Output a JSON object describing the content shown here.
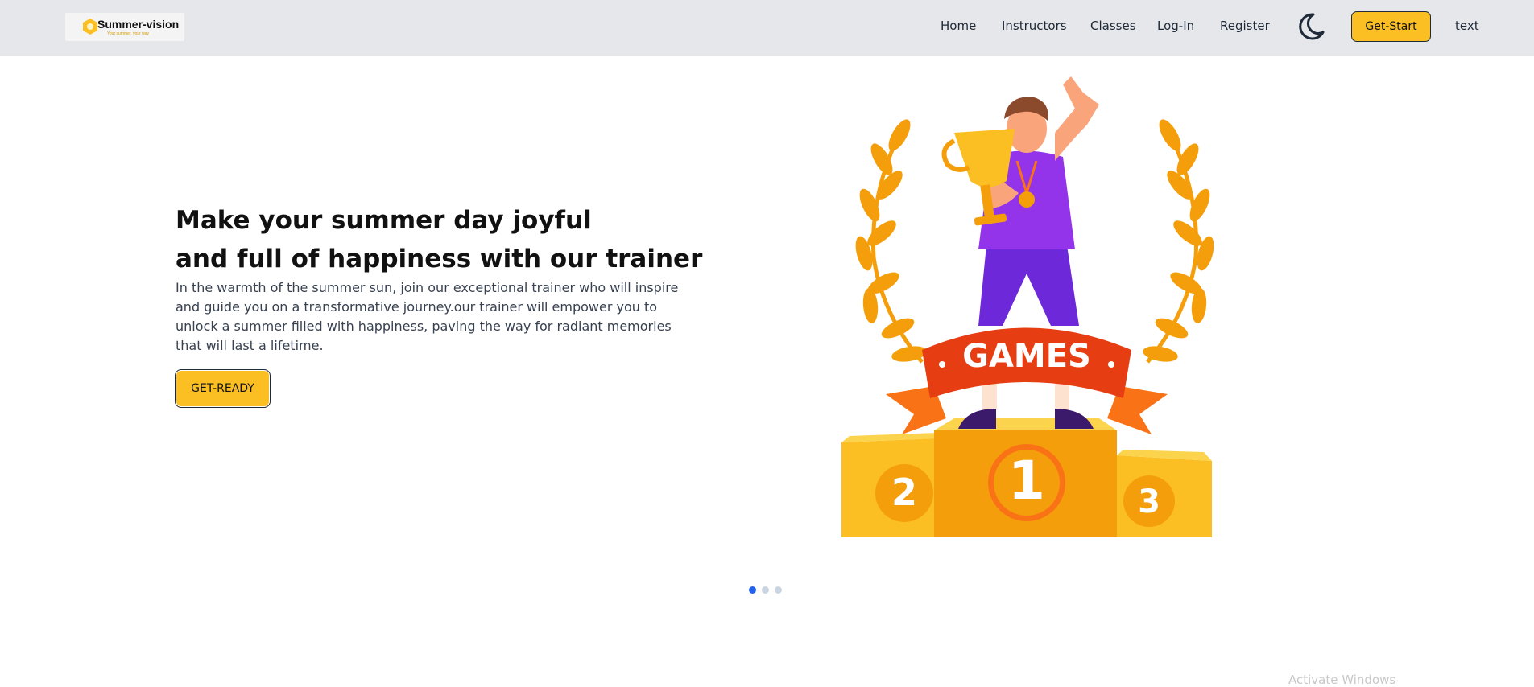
{
  "brand": {
    "name": "Summer-vision",
    "tagline": "Your summer, your way"
  },
  "nav": {
    "links": [
      "Home",
      "Instructors",
      "Classes",
      "Log-In",
      "Register"
    ],
    "cta_label": "Get-Start",
    "extra_label": "text",
    "theme_icon": "moon-icon"
  },
  "hero": {
    "title_line1": "Make your summer day joyful",
    "title_line2": "and full of happiness with our trainer",
    "description": "In the warmth of the summer sun, join our exceptional trainer who will inspire and guide you on a transformative journey.our trainer will empower you to unlock a summer filled with happiness, paving the way for radiant memories that will last a lifetime.",
    "button_label": "GET-READY"
  },
  "illustration": {
    "banner_text": "GAMES",
    "podium_labels": [
      "2",
      "1",
      "3"
    ]
  },
  "carousel": {
    "slide_count": 3,
    "active_index": 0
  },
  "watermark": {
    "text": "Activate Windows"
  },
  "colors": {
    "accent": "#fbbf24",
    "navbar": "#e5e7eb",
    "active_dot": "#2563eb",
    "banner": "#e63e12",
    "shirt": "#9333ea"
  }
}
